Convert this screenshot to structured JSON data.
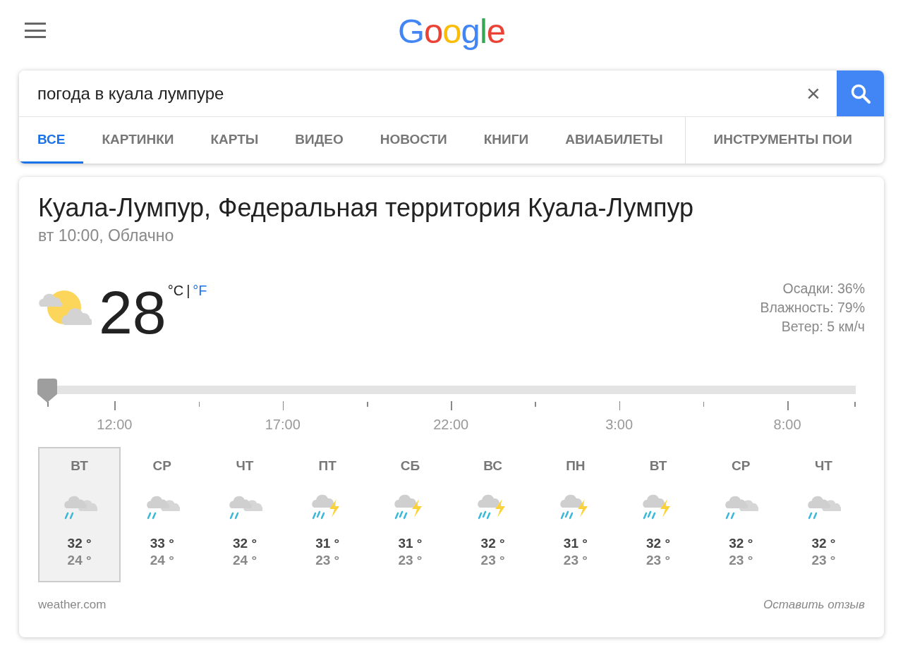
{
  "logo": [
    {
      "letter": "G",
      "color": "#4285f4"
    },
    {
      "letter": "o",
      "color": "#ea4335"
    },
    {
      "letter": "o",
      "color": "#fbbc05"
    },
    {
      "letter": "g",
      "color": "#4285f4"
    },
    {
      "letter": "l",
      "color": "#34a853"
    },
    {
      "letter": "e",
      "color": "#ea4335"
    }
  ],
  "search": {
    "value": "погода в куала лумпуре",
    "clear_symbol": "×"
  },
  "tabs": [
    {
      "label": "ВСЕ",
      "selected": true
    },
    {
      "label": "КАРТИНКИ",
      "selected": false
    },
    {
      "label": "КАРТЫ",
      "selected": false
    },
    {
      "label": "ВИДЕО",
      "selected": false
    },
    {
      "label": "НОВОСТИ",
      "selected": false
    },
    {
      "label": "КНИГИ",
      "selected": false
    },
    {
      "label": "АВИАБИЛЕТЫ",
      "selected": false
    },
    {
      "label": "ИНСТРУМЕНТЫ ПОИ",
      "selected": false
    }
  ],
  "weather": {
    "location": "Куала-Лумпур, Федеральная территория Куала-Лумпур",
    "subtitle": "вт 10:00, Облачно",
    "temperature": "28",
    "unit_c": "°C",
    "unit_separator": "|",
    "unit_f": "°F",
    "details": [
      "Осадки: 36%",
      "Влажность: 79%",
      "Ветер: 5 км/ч"
    ],
    "timeline": {
      "level": 0,
      "labels": [
        "12:00",
        "17:00",
        "22:00",
        "3:00",
        "8:00"
      ]
    },
    "days": [
      {
        "day": "ВТ",
        "kind": "rain",
        "high": "32 °",
        "low": "24 °",
        "selected": true
      },
      {
        "day": "СР",
        "kind": "rain",
        "high": "33 °",
        "low": "24 °",
        "selected": false
      },
      {
        "day": "ЧТ",
        "kind": "rain",
        "high": "32 °",
        "low": "24 °",
        "selected": false
      },
      {
        "day": "ПТ",
        "kind": "storm",
        "high": "31 °",
        "low": "23 °",
        "selected": false
      },
      {
        "day": "СБ",
        "kind": "storm",
        "high": "31 °",
        "low": "23 °",
        "selected": false
      },
      {
        "day": "ВС",
        "kind": "storm",
        "high": "32 °",
        "low": "23 °",
        "selected": false
      },
      {
        "day": "ПН",
        "kind": "storm",
        "high": "31 °",
        "low": "23 °",
        "selected": false
      },
      {
        "day": "ВТ",
        "kind": "storm",
        "high": "32 °",
        "low": "23 °",
        "selected": false
      },
      {
        "day": "СР",
        "kind": "rain",
        "high": "32 °",
        "low": "23 °",
        "selected": false
      },
      {
        "day": "ЧТ",
        "kind": "rain",
        "high": "32 °",
        "low": "23 °",
        "selected": false
      }
    ],
    "source": "weather.com",
    "feedback": "Оставить отзыв"
  }
}
